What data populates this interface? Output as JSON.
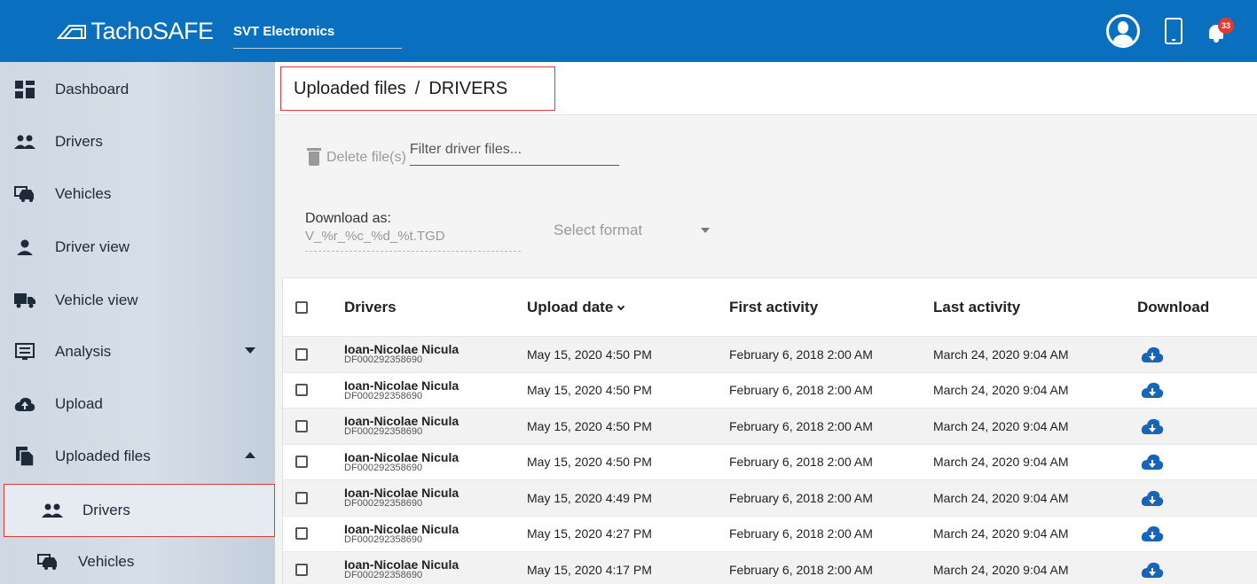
{
  "header": {
    "brand": "TachoSAFE",
    "company": "SVT Electronics",
    "notification_count": "33"
  },
  "sidebar": {
    "items": [
      {
        "label": "Dashboard",
        "icon": "dashboard-icon"
      },
      {
        "label": "Drivers",
        "icon": "people-icon"
      },
      {
        "label": "Vehicles",
        "icon": "car-icon"
      },
      {
        "label": "Driver view",
        "icon": "person-icon"
      },
      {
        "label": "Vehicle view",
        "icon": "truck-icon"
      },
      {
        "label": "Analysis",
        "icon": "analysis-icon"
      },
      {
        "label": "Upload",
        "icon": "cloud-upload-icon"
      },
      {
        "label": "Uploaded files",
        "icon": "files-icon"
      },
      {
        "label": "Drivers",
        "icon": "people-icon"
      },
      {
        "label": "Vehicles",
        "icon": "car-icon"
      }
    ]
  },
  "breadcrumb": {
    "section": "Uploaded files",
    "separator": "/",
    "page": "DRIVERS"
  },
  "toolbar": {
    "delete_label": "Delete file(s)",
    "filter_placeholder": "Filter driver files..."
  },
  "download": {
    "label": "Download as:",
    "pattern": "V_%r_%c_%d_%t.TGD",
    "format_placeholder": "Select format"
  },
  "table": {
    "columns": {
      "drivers": "Drivers",
      "upload_date": "Upload date",
      "first_activity": "First activity",
      "last_activity": "Last activity",
      "download": "Download"
    },
    "rows": [
      {
        "name": "Ioan-Nicolae Nicula",
        "id": "DF000292358690",
        "upload": "May 15, 2020 4:50 PM",
        "first": "February 6, 2018 2:00 AM",
        "last": "March 24, 2020 9:04 AM"
      },
      {
        "name": "Ioan-Nicolae Nicula",
        "id": "DF000292358690",
        "upload": "May 15, 2020 4:50 PM",
        "first": "February 6, 2018 2:00 AM",
        "last": "March 24, 2020 9:04 AM"
      },
      {
        "name": "Ioan-Nicolae Nicula",
        "id": "DF000292358690",
        "upload": "May 15, 2020 4:50 PM",
        "first": "February 6, 2018 2:00 AM",
        "last": "March 24, 2020 9:04 AM"
      },
      {
        "name": "Ioan-Nicolae Nicula",
        "id": "DF000292358690",
        "upload": "May 15, 2020 4:50 PM",
        "first": "February 6, 2018 2:00 AM",
        "last": "March 24, 2020 9:04 AM"
      },
      {
        "name": "Ioan-Nicolae Nicula",
        "id": "DF000292358690",
        "upload": "May 15, 2020 4:49 PM",
        "first": "February 6, 2018 2:00 AM",
        "last": "March 24, 2020 9:04 AM"
      },
      {
        "name": "Ioan-Nicolae Nicula",
        "id": "DF000292358690",
        "upload": "May 15, 2020 4:27 PM",
        "first": "February 6, 2018 2:00 AM",
        "last": "March 24, 2020 9:04 AM"
      },
      {
        "name": "Ioan-Nicolae Nicula",
        "id": "DF000292358690",
        "upload": "May 15, 2020 4:17 PM",
        "first": "February 6, 2018 2:00 AM",
        "last": "March 24, 2020 9:04 AM"
      }
    ]
  },
  "colors": {
    "header": "#0a6fbe",
    "highlight_border": "#d93a3a",
    "download_icon": "#1565b8"
  }
}
